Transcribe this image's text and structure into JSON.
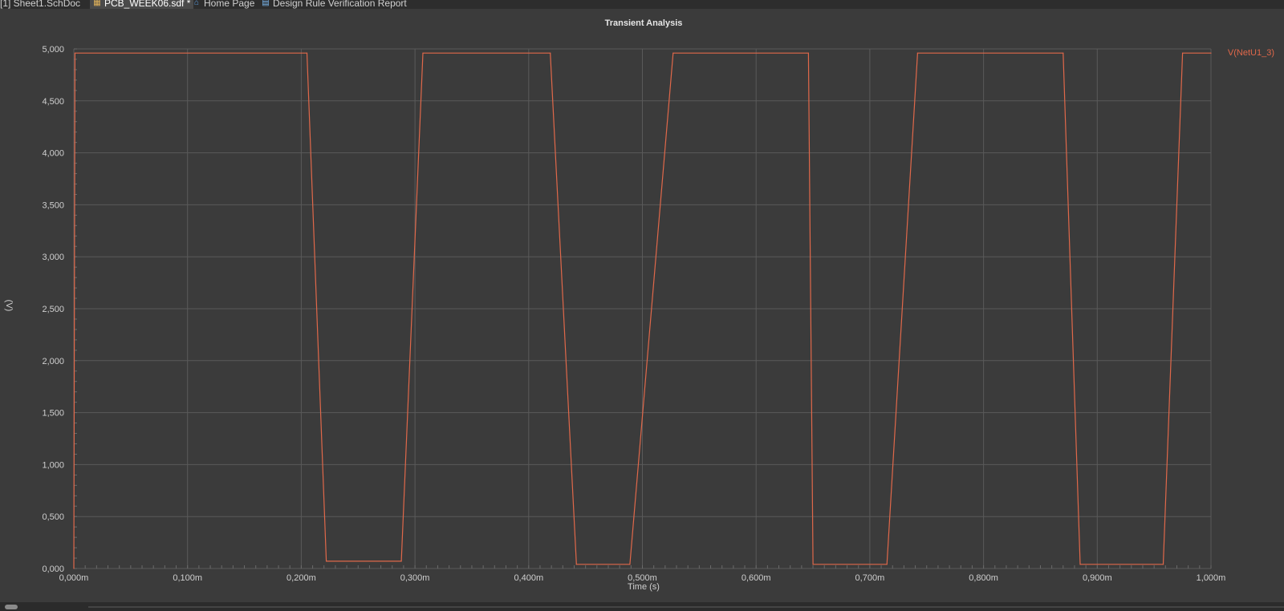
{
  "tabs": [
    {
      "label": "[1] Sheet1.SchDoc",
      "icon": "schematic-icon",
      "active": false
    },
    {
      "label": "PCB_WEEK06.sdf *",
      "icon": "simulation-file-icon",
      "active": true
    },
    {
      "label": "Home Page",
      "icon": "home-icon",
      "active": false
    },
    {
      "label": "Design Rule Verification Report",
      "icon": "report-icon",
      "active": false
    }
  ],
  "colors": {
    "background": "#3b3b3b",
    "grid": "#5a5a5a",
    "trace": "#e0684a",
    "text": "#cfcfcf",
    "title": "#e6e6e6"
  },
  "chart_data": {
    "type": "line",
    "title": "Transient Analysis",
    "xlabel": "Time (s)",
    "ylabel": "(V)",
    "xlim": [
      0,
      1.0
    ],
    "ylim": [
      0,
      5.0
    ],
    "x_unit": "ms",
    "x_ticks": [
      "0,000m",
      "0,100m",
      "0,200m",
      "0,300m",
      "0,400m",
      "0,500m",
      "0,600m",
      "0,700m",
      "0,800m",
      "0,900m",
      "1,000m"
    ],
    "y_ticks": [
      "0,000",
      "0,500",
      "1,000",
      "1,500",
      "2,000",
      "2,500",
      "3,000",
      "3,500",
      "4,000",
      "4,500",
      "5,000"
    ],
    "legend_position": "top-right",
    "grid": true,
    "series": [
      {
        "name": "V(NetU1_3)",
        "color": "#e0684a",
        "x": [
          0.0,
          0.001,
          0.205,
          0.222,
          0.288,
          0.307,
          0.419,
          0.442,
          0.489,
          0.527,
          0.646,
          0.65,
          0.715,
          0.742,
          0.87,
          0.885,
          0.958,
          0.975,
          1.0
        ],
        "y": [
          0.0,
          4.96,
          4.96,
          0.07,
          0.07,
          4.96,
          4.96,
          0.04,
          0.04,
          4.96,
          4.96,
          0.04,
          0.04,
          4.96,
          4.96,
          0.04,
          0.04,
          4.96,
          4.96
        ]
      }
    ]
  }
}
